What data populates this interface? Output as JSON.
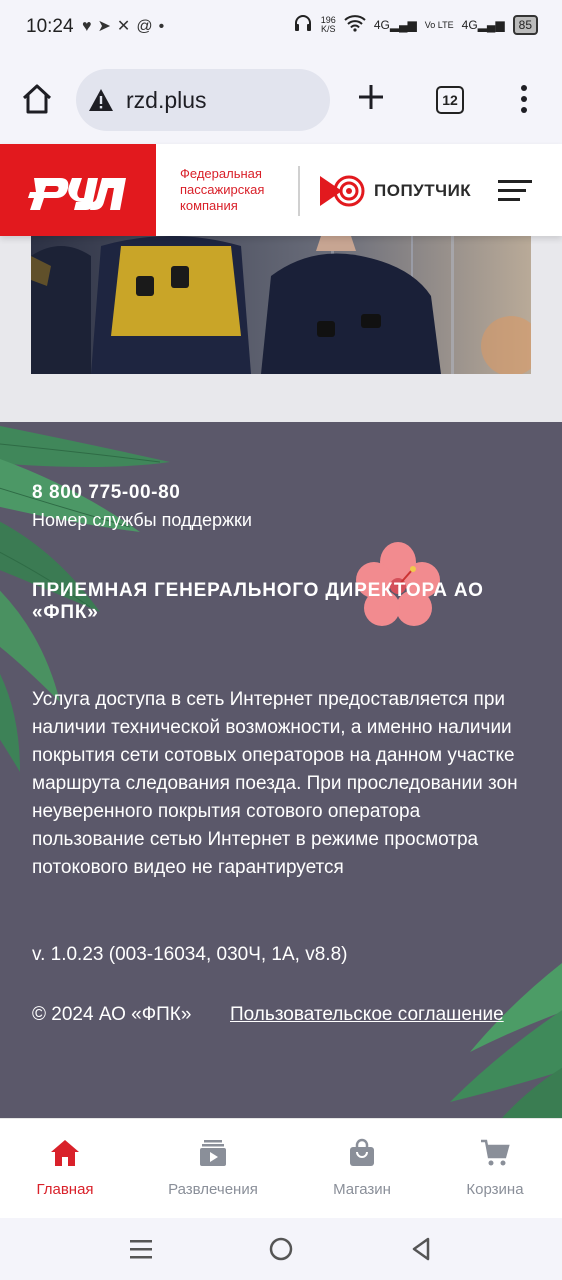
{
  "status_bar": {
    "time": "10:24",
    "net_speed_value": "196",
    "net_speed_unit": "K/S",
    "sim1": "4G",
    "volte": "Vo LTE",
    "sim2": "4G",
    "battery": "85"
  },
  "browser": {
    "url": "rzd.plus",
    "tabs_count": "12"
  },
  "header": {
    "fpk_line1": "Федеральная",
    "fpk_line2": "пассажирская",
    "fpk_line3": "компания",
    "poputchik": "ПОПУТЧИК"
  },
  "footer": {
    "phone": "8 800 775-00-80",
    "phone_caption": "Номер службы поддержки",
    "director": "ПРИЕМНАЯ ГЕНЕРАЛЬНОГО ДИРЕКТОРА АО «ФПК»",
    "notice": "Услуга доступа в сеть Интернет предоставляется при наличии технической возможности, а именно наличии покрытия сети сотовых операторов на данном участке маршрута следования поезда. При проследовании зон неуверенного покрытия сотового оператора пользование сетью Интернет в режиме просмотра потокового видео не гарантируется",
    "version": "v. 1.0.23 (003-16034, 030Ч, 1А, v8.8)",
    "copyright": "© 2024 АО «ФПК»",
    "agreement": "Пользовательское соглашение"
  },
  "bottom_nav": {
    "items": [
      {
        "label": "Главная",
        "icon": "home-icon",
        "active": true
      },
      {
        "label": "Развлечения",
        "icon": "media-icon",
        "active": false
      },
      {
        "label": "Магазин",
        "icon": "shopping-bag-icon",
        "active": false
      },
      {
        "label": "Корзина",
        "icon": "cart-icon",
        "active": false
      }
    ]
  },
  "colors": {
    "brand_red": "#e2191e",
    "footer_bg": "#5b586a",
    "nav_active": "#d9212a",
    "nav_inactive": "#8a8f99"
  }
}
